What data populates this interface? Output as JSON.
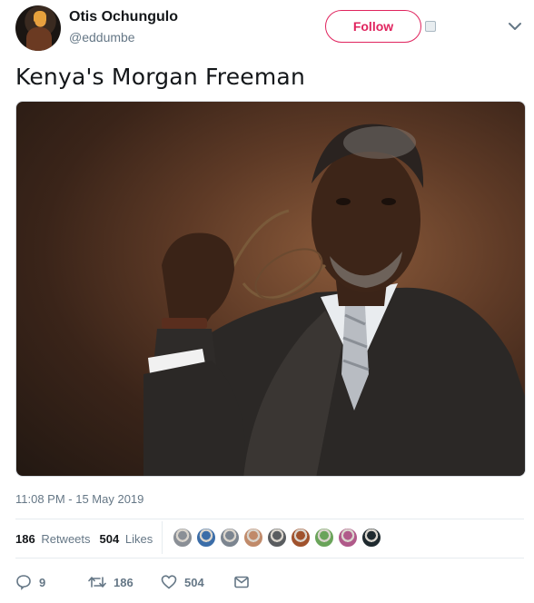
{
  "author": {
    "display_name": "Otis Ochungulo",
    "handle": "@eddumbe"
  },
  "follow_label": "Follow",
  "tweet": {
    "text": "Kenya's Morgan Freeman",
    "timestamp": "11:08 PM - 15 May 2019"
  },
  "stats": {
    "retweets_count": "186",
    "retweets_label": "Retweets",
    "likes_count": "504",
    "likes_label": "Likes"
  },
  "actions": {
    "reply_count": "9",
    "retweet_count": "186",
    "like_count": "504"
  },
  "colors": {
    "accent": "#e0245e",
    "muted": "#657786",
    "text": "#14171a"
  },
  "likers": [
    "#8a8f96",
    "#3b6da8",
    "#7c8590",
    "#c08a6a",
    "#5a5d60",
    "#a0522d",
    "#6aa45a",
    "#b05a8a",
    "#1f2a2f"
  ]
}
